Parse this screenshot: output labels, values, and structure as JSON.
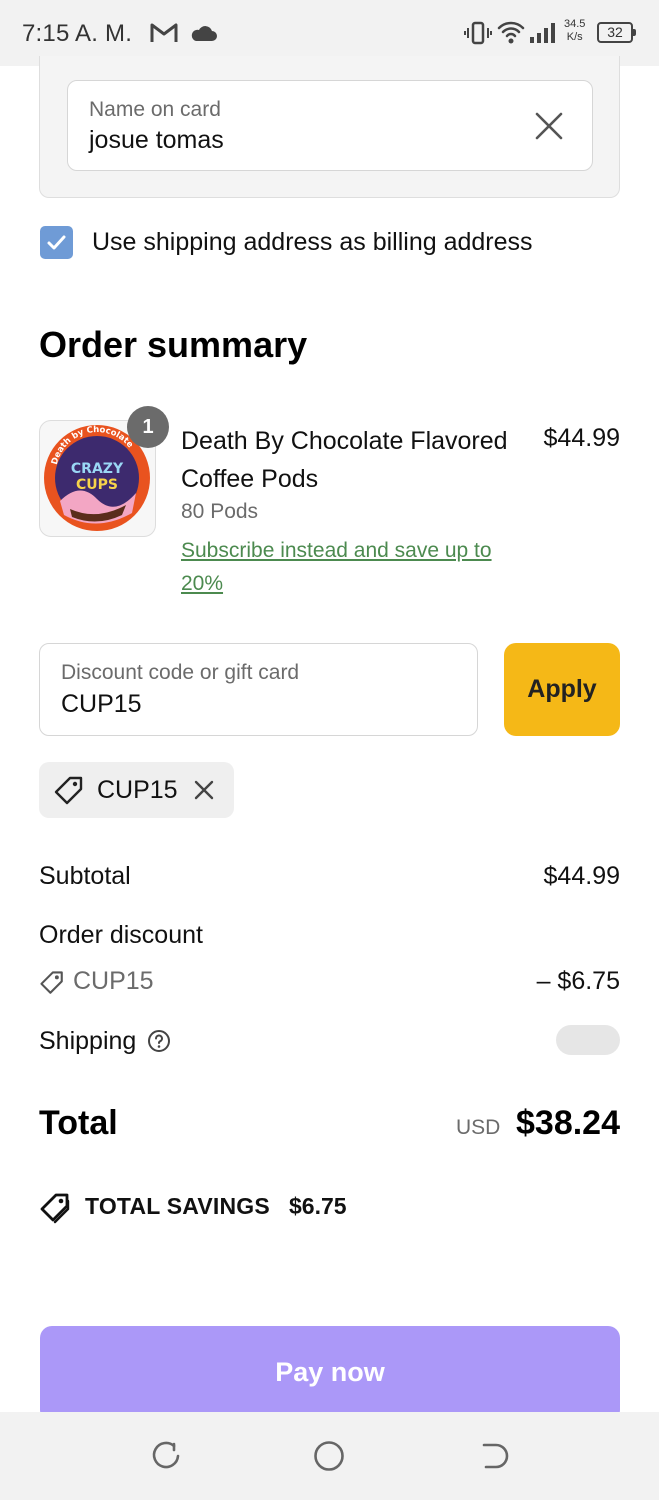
{
  "status_bar": {
    "time": "7:15 A. M.",
    "net_speed_value": "34.5",
    "net_speed_unit": "K/s",
    "battery": "32"
  },
  "card_form": {
    "name_label": "Name on card",
    "name_value": "josue tomas"
  },
  "billing": {
    "checkbox_label": "Use shipping address as billing address",
    "checked": true
  },
  "order_summary": {
    "title": "Order summary",
    "item": {
      "quantity": "1",
      "name": "Death By Chocolate Flavored Coffee Pods",
      "variant": "80 Pods",
      "subscribe_link": "Subscribe instead and save up to 20%",
      "price": "$44.99",
      "thumb_text_top": "Death by Chocolate",
      "thumb_brand_1": "CRAZY",
      "thumb_brand_2": "CUPS"
    }
  },
  "discount": {
    "placeholder_label": "Discount code or gift card",
    "value": "CUP15",
    "apply_label": "Apply",
    "applied_code": "CUP15"
  },
  "totals": {
    "subtotal_label": "Subtotal",
    "subtotal_value": "$44.99",
    "order_discount_label": "Order discount",
    "discount_code": "CUP15",
    "discount_value": "– $6.75",
    "shipping_label": "Shipping",
    "total_label": "Total",
    "currency": "USD",
    "total_value": "$38.24",
    "savings_label": "TOTAL SAVINGS",
    "savings_value": "$6.75"
  },
  "actions": {
    "pay_label": "Pay now"
  },
  "colors": {
    "apply_button": "#f5b817",
    "pay_button": "#ab98f8",
    "checkbox": "#6f9bd6",
    "link": "#4c8a4f"
  }
}
